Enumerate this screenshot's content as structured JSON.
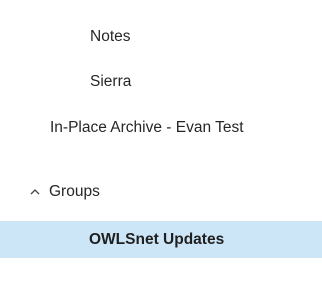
{
  "folder_pane": {
    "items": [
      {
        "label": "Notes"
      },
      {
        "label": "Sierra"
      },
      {
        "label": "In-Place Archive - Evan Test"
      }
    ],
    "groups_section": {
      "label": "Groups",
      "expanded": true,
      "toggle_icon": "chevron-up-icon",
      "items": [
        {
          "label": "OWLSnet Updates",
          "selected": true
        }
      ]
    },
    "colors": {
      "selected_background": "#cde6f7",
      "text": "#262626"
    }
  }
}
